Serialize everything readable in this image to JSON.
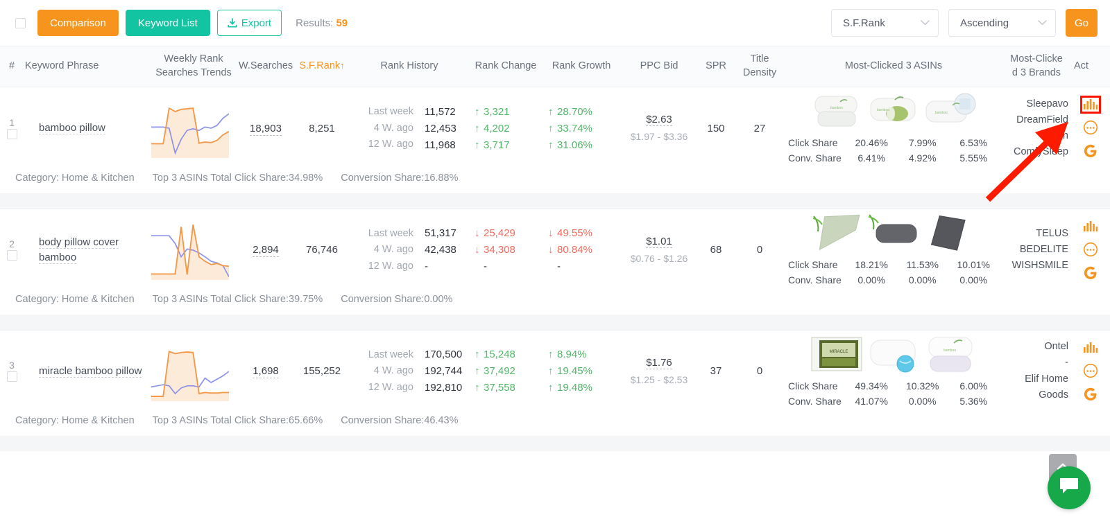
{
  "toolbar": {
    "select_all_checkbox": "",
    "comparison_label": "Comparison",
    "keyword_list_label": "Keyword List",
    "export_label": "Export",
    "export_icon": "download-icon",
    "results_label": "Results:",
    "results_count": "59",
    "sort_field": "S.F.Rank",
    "sort_order": "Ascending",
    "go_label": "Go",
    "accent_orange": "#f7941e",
    "accent_teal": "#13c4a3"
  },
  "table": {
    "headers": {
      "index": "#",
      "keyword_phrase": "Keyword Phrase",
      "weekly_rank_line1": "Weekly Rank",
      "weekly_rank_line2": "Searches Trends",
      "w_searches": "W.Searches",
      "sf_rank": "S.F.Rank",
      "sf_rank_sort_arrow": "↑",
      "rank_history": "Rank History",
      "rank_change": "Rank Change",
      "rank_growth": "Rank Growth",
      "ppc_bid": "PPC Bid",
      "spr": "SPR",
      "title_density_line1": "Title",
      "title_density_line2": "Density",
      "most_clicked_asins": "Most-Clicked 3 ASINs",
      "most_clicked_brands_line1": "Most-Clicke",
      "most_clicked_brands_line2": "d 3 Brands",
      "action": "Act"
    },
    "share_labels": {
      "click_share": "Click Share",
      "conv_share": "Conv. Share"
    },
    "rows": [
      {
        "index": "1",
        "keyword": "bamboo pillow",
        "w_searches": "18,903",
        "sf_rank": "8,251",
        "history": [
          {
            "period": "Last week",
            "value": "11,572",
            "change": "3,321",
            "change_dir": "up",
            "growth": "28.70%",
            "growth_dir": "up"
          },
          {
            "period": "4 W. ago",
            "value": "12,453",
            "change": "4,202",
            "change_dir": "up",
            "growth": "33.74%",
            "growth_dir": "up"
          },
          {
            "period": "12 W. ago",
            "value": "11,968",
            "change": "3,717",
            "change_dir": "up",
            "growth": "31.06%",
            "growth_dir": "up"
          }
        ],
        "ppc_bid": "$2.63",
        "ppc_range": "$1.97 - $3.36",
        "spr": "150",
        "title_density": "27",
        "asins": [
          {
            "click_share": "20.46%",
            "conv_share": "6.41%",
            "image": "white-bamboo-pillow-pair"
          },
          {
            "click_share": "7.99%",
            "conv_share": "4.92%",
            "image": "bamboo-pillow-with-green-roll"
          },
          {
            "click_share": "6.53%",
            "conv_share": "5.55%",
            "image": "bamboo-pillow-zoom-inset"
          }
        ],
        "brands": [
          "Sleepavo",
          "DreamField Linen",
          "ComfySleep"
        ],
        "category": "Category: Home & Kitchen",
        "total_click_share": "Top 3 ASINs Total Click Share:34.98%",
        "conversion_share": "Conversion Share:16.88%",
        "actions": [
          "bar-chart-icon",
          "more-dots-icon",
          "google-g-icon"
        ],
        "action_highlighted": "bar-chart-icon"
      },
      {
        "index": "2",
        "keyword": "body pillow cover bamboo",
        "w_searches": "2,894",
        "sf_rank": "76,746",
        "history": [
          {
            "period": "Last week",
            "value": "51,317",
            "change": "25,429",
            "change_dir": "down",
            "growth": "49.55%",
            "growth_dir": "down"
          },
          {
            "period": "4 W. ago",
            "value": "42,438",
            "change": "34,308",
            "change_dir": "down",
            "growth": "80.84%",
            "growth_dir": "down"
          },
          {
            "period": "12 W. ago",
            "value": "-",
            "change": "-",
            "change_dir": "none",
            "growth": "-",
            "growth_dir": "none"
          }
        ],
        "ppc_bid": "$1.01",
        "ppc_range": "$0.76 - $1.26",
        "spr": "68",
        "title_density": "0",
        "asins": [
          {
            "click_share": "18.21%",
            "conv_share": "0.00%",
            "image": "sage-green-body-pillow"
          },
          {
            "click_share": "11.53%",
            "conv_share": "0.00%",
            "image": "grey-body-pillow"
          },
          {
            "click_share": "10.01%",
            "conv_share": "0.00%",
            "image": "dark-grey-body-pillow"
          }
        ],
        "brands": [
          "TELUS",
          "BEDELITE",
          "WISHSMILE"
        ],
        "category": "Category: Home & Kitchen",
        "total_click_share": "Top 3 ASINs Total Click Share:39.75%",
        "conversion_share": "Conversion Share:0.00%",
        "actions": [
          "bar-chart-icon",
          "more-dots-icon",
          "google-g-icon"
        ],
        "action_highlighted": ""
      },
      {
        "index": "3",
        "keyword": "miracle bamboo pillow",
        "w_searches": "1,698",
        "sf_rank": "155,252",
        "history": [
          {
            "period": "Last week",
            "value": "170,500",
            "change": "15,248",
            "change_dir": "up",
            "growth": "8.94%",
            "growth_dir": "up"
          },
          {
            "period": "4 W. ago",
            "value": "192,744",
            "change": "37,492",
            "change_dir": "up",
            "growth": "19.45%",
            "growth_dir": "up"
          },
          {
            "period": "12 W. ago",
            "value": "192,810",
            "change": "37,558",
            "change_dir": "up",
            "growth": "19.48%",
            "growth_dir": "up"
          }
        ],
        "ppc_bid": "$1.76",
        "ppc_range": "$1.25 - $2.53",
        "spr": "37",
        "title_density": "0",
        "asins": [
          {
            "click_share": "49.34%",
            "conv_share": "41.07%",
            "image": "miracle-bamboo-pillow-box"
          },
          {
            "click_share": "10.32%",
            "conv_share": "0.00%",
            "image": "white-pillow-with-globe"
          },
          {
            "click_share": "6.00%",
            "conv_share": "5.36%",
            "image": "stacked-bamboo-pillows"
          }
        ],
        "brands": [
          "Ontel",
          "-",
          "Elif Home Goods"
        ],
        "category": "Category: Home & Kitchen",
        "total_click_share": "Top 3 ASINs Total Click Share:65.66%",
        "conversion_share": "Conversion Share:46.43%",
        "actions": [
          "bar-chart-icon",
          "more-dots-icon",
          "google-g-icon"
        ],
        "action_highlighted": ""
      }
    ]
  },
  "overlays": {
    "scroll_top_icon": "chevron-up-icon",
    "chat_icon": "chat-bubble-icon",
    "annotation_arrow": "red-arrow-pointing-to-bar-chart-icon"
  },
  "sparklines": {
    "series_colors": {
      "orange": "#f2994a",
      "blue": "#8b92e8",
      "fill": "#fdebda"
    },
    "rows": [
      {
        "orange": [
          0.22,
          0.22,
          0.22,
          0.86,
          0.8,
          0.84,
          0.85,
          0.86,
          0.23,
          0.25,
          0.24,
          0.28,
          0.38,
          0.44
        ],
        "blue": [
          0.52,
          0.52,
          0.52,
          0.5,
          0.05,
          0.3,
          0.46,
          0.49,
          0.46,
          0.52,
          0.5,
          0.55,
          0.68,
          0.76
        ]
      },
      {
        "orange": [
          0.07,
          0.07,
          0.07,
          0.07,
          0.07,
          0.92,
          0.06,
          0.96,
          0.38,
          0.3,
          0.24,
          0.26,
          0.22,
          0.21
        ],
        "blue": [
          0.76,
          0.76,
          0.76,
          0.76,
          0.62,
          0.38,
          0.52,
          0.5,
          0.45,
          0.38,
          0.3,
          0.27,
          0.22,
          0.02
        ]
      },
      {
        "orange": [
          0.05,
          0.05,
          0.05,
          0.86,
          0.82,
          0.84,
          0.85,
          0.84,
          0.1,
          0.12,
          0.11,
          0.11,
          0.12,
          0.12
        ],
        "blue": [
          0.22,
          0.24,
          0.26,
          0.24,
          0.1,
          0.2,
          0.24,
          0.24,
          0.22,
          0.38,
          0.3,
          0.36,
          0.42,
          0.5
        ]
      }
    ]
  }
}
